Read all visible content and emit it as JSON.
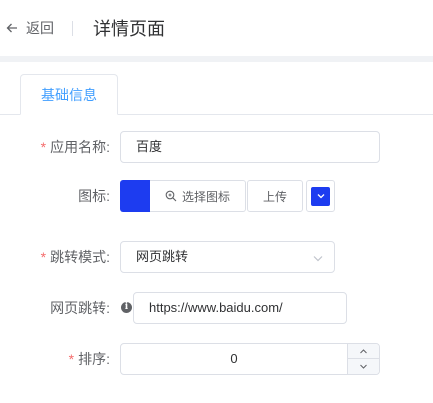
{
  "header": {
    "back_label": "返回",
    "title": "详情页面"
  },
  "tabs": [
    {
      "label": "基础信息",
      "active": true
    }
  ],
  "form": {
    "required_mark": "*",
    "app_name": {
      "label": "应用名称:",
      "value": "百度",
      "required": true
    },
    "icon": {
      "label": "图标:",
      "color": "#1d3cf0",
      "pick_label": "选择图标",
      "upload_label": "上传"
    },
    "jump_mode": {
      "label": "跳转模式:",
      "value": "网页跳转",
      "required": true
    },
    "web_jump": {
      "label": "网页跳转:",
      "value": "https://www.baidu.com/"
    },
    "sort": {
      "label": "排序:",
      "value": "0",
      "required": true
    }
  },
  "colors": {
    "accent": "#409eff",
    "required": "#f56c6c",
    "icon_color": "#1d3cf0"
  }
}
